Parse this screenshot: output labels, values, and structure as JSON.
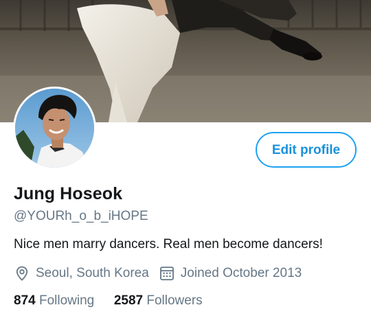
{
  "profile": {
    "display_name": "Jung Hoseok",
    "handle": "@YOURh_o_b_iHOPE",
    "bio": "Nice men marry dancers. Real men become dancers!",
    "location": "Seoul, South Korea",
    "joined": "Joined October 2013"
  },
  "actions": {
    "edit_profile_label": "Edit profile"
  },
  "stats": {
    "following_count": "874",
    "following_label": "Following",
    "followers_count": "2587",
    "followers_label": "Followers"
  },
  "icons": {
    "location": "location-pin-icon",
    "joined": "calendar-icon"
  },
  "colors": {
    "accent": "#1da1f2",
    "text_primary": "#14171a",
    "text_secondary": "#657786"
  }
}
